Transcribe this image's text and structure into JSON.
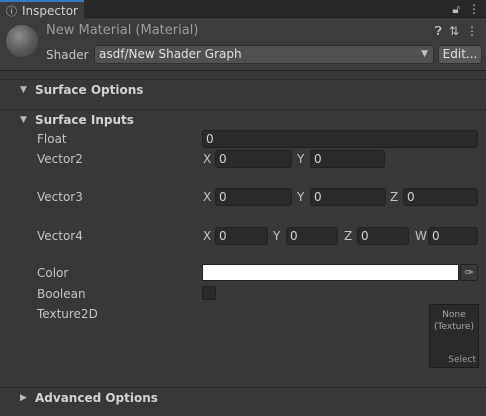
{
  "tab": {
    "title": "Inspector",
    "icon": "info-icon"
  },
  "tabbar_icons": [
    "lock-icon",
    "kebab-menu-icon"
  ],
  "header": {
    "material_title": "New Material (Material)",
    "icons": [
      "help-icon",
      "preset-sliders-icon",
      "kebab-menu-icon"
    ],
    "shader_label": "Shader",
    "shader_value": "asdf/New Shader Graph",
    "edit_label": "Edit..."
  },
  "sections": {
    "surface_options": "Surface Options",
    "surface_inputs": "Surface Inputs",
    "advanced_options": "Advanced Options"
  },
  "properties": {
    "float": {
      "label": "Float",
      "value": "0"
    },
    "vector2": {
      "label": "Vector2",
      "x": "0",
      "y": "0"
    },
    "vector3": {
      "label": "Vector3",
      "x": "0",
      "y": "0",
      "z": "0"
    },
    "vector4": {
      "label": "Vector4",
      "x": "0",
      "y": "0",
      "z": "0",
      "w": "0"
    },
    "color": {
      "label": "Color",
      "value": "#ffffff"
    },
    "boolean": {
      "label": "Boolean",
      "checked": false
    },
    "texture2d": {
      "label": "Texture2D",
      "slot_line1": "None",
      "slot_line2": "(Texture)",
      "select_label": "Select"
    }
  },
  "axes": {
    "x": "X",
    "y": "Y",
    "z": "Z",
    "w": "W"
  },
  "colors": {
    "background": "#383838",
    "accent_tab": "#3a79bb"
  }
}
